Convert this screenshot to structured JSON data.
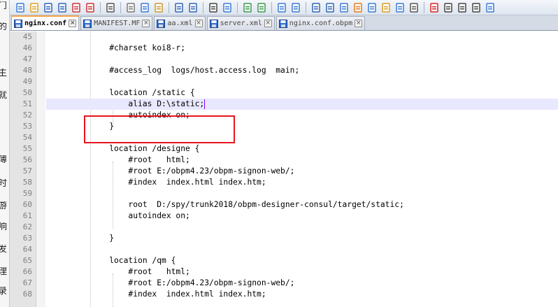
{
  "left_strip_chars": [
    "门",
    "的",
    "主",
    "就",
    "薄",
    "时",
    "游",
    "响",
    "发",
    "理",
    "录"
  ],
  "toolbar": {
    "icons": [
      "new-file-icon",
      "open-file-icon",
      "save-icon",
      "save-all-icon",
      "close-icon",
      "close-all-icon",
      "print-icon",
      "cut-icon",
      "copy-icon",
      "paste-icon",
      "undo-icon",
      "redo-icon",
      "find-icon",
      "replace-icon",
      "zoom-in-icon",
      "zoom-out-icon",
      "sync-vertical-icon",
      "sync-horizontal-icon",
      "word-wrap-icon",
      "show-all-chars-icon",
      "indent-guide-icon",
      "language-icon",
      "doc-map-icon",
      "function-list-icon",
      "folder-workspace-icon",
      "monitor-icon",
      "record-macro-icon",
      "stop-record-icon",
      "play-macro-icon",
      "run-macro-multiple-icon",
      "save-macro-icon"
    ]
  },
  "tabs": [
    {
      "label": "nginx.conf",
      "active": true,
      "color": "#2b6cd4"
    },
    {
      "label": "MANIFEST.MF",
      "active": false,
      "color": "#2b6cd4"
    },
    {
      "label": "aa.xml",
      "active": false,
      "color": "#2b6cd4"
    },
    {
      "label": "server.xml",
      "active": false,
      "color": "#2b6cd4"
    },
    {
      "label": "nginx.conf.obpm",
      "active": false,
      "color": "#2b6cd4"
    }
  ],
  "editor": {
    "current_line": 51,
    "lines": [
      {
        "n": "45",
        "text": ""
      },
      {
        "n": "46",
        "text": "    #charset koi8-r;"
      },
      {
        "n": "47",
        "text": ""
      },
      {
        "n": "48",
        "text": "    #access_log  logs/host.access.log  main;"
      },
      {
        "n": "49",
        "text": ""
      },
      {
        "n": "50",
        "text": "    location /static {"
      },
      {
        "n": "51",
        "text": "        alias D:\\static;"
      },
      {
        "n": "52",
        "text": "        autoindex on;"
      },
      {
        "n": "53",
        "text": "    }"
      },
      {
        "n": "54",
        "text": ""
      },
      {
        "n": "55",
        "text": "    location /designe {"
      },
      {
        "n": "56",
        "text": "        #root   html;"
      },
      {
        "n": "57",
        "text": "        #root E:/obpm4.23/obpm-signon-web/;"
      },
      {
        "n": "58",
        "text": "        #index  index.html index.htm;"
      },
      {
        "n": "59",
        "text": ""
      },
      {
        "n": "60",
        "text": "        root  D:/spy/trunk2018/obpm-designer-consul/target/static;"
      },
      {
        "n": "61",
        "text": "        autoindex on;"
      },
      {
        "n": "62",
        "text": ""
      },
      {
        "n": "63",
        "text": "    }"
      },
      {
        "n": "64",
        "text": ""
      },
      {
        "n": "65",
        "text": "    location /qm {"
      },
      {
        "n": "66",
        "text": "        #root   html;"
      },
      {
        "n": "67",
        "text": "        #root E:/obpm4.23/obpm-signon-web/;"
      },
      {
        "n": "68",
        "text": "        #index  index.html index.htm;"
      }
    ]
  },
  "annotation_color": "#e8141e"
}
